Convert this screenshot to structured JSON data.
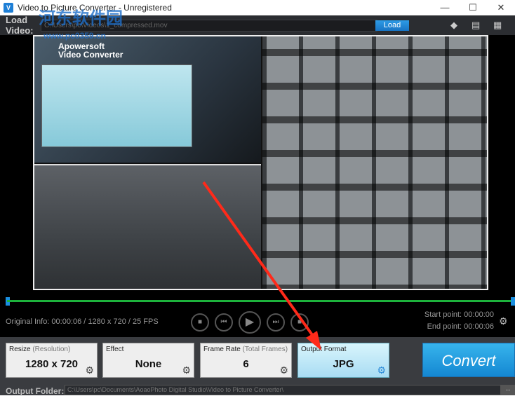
{
  "window": {
    "title": "Video to Picture Converter - Unregistered",
    "minimize": "—",
    "maximize": "☐",
    "close": "✕"
  },
  "load": {
    "label": "Load Video:",
    "path": "C:\\Users\\pc\\Videos\\1_compressed.mov",
    "button": "Load"
  },
  "video": {
    "brand_line1": "Apowersoft",
    "brand_line2": "Video Converter"
  },
  "info": "Original Info: 00:00:06 / 1280 x 720 / 25 FPS",
  "start_point": "Start point: 00:00:00",
  "end_point": "End point: 00:00:06",
  "controls": {
    "stop": "■",
    "prev": "⏮",
    "play": "▶",
    "next": "⏭",
    "snap": "■"
  },
  "cards": [
    {
      "label": "Resize",
      "label_sub": " (Resolution)",
      "value": "1280 x 720"
    },
    {
      "label": "Effect",
      "label_sub": "",
      "value": "None"
    },
    {
      "label": "Frame Rate",
      "label_sub": " (Total Frames)",
      "value": "6"
    },
    {
      "label": "Output Format",
      "label_sub": "",
      "value": "JPG"
    }
  ],
  "convert": "Convert",
  "output": {
    "label": "Output Folder:",
    "path": "C:\\Users\\pc\\Documents\\AoaoPhoto Digital Studio\\Video to Picture Converter\\",
    "browse": "..."
  },
  "watermark": {
    "line1": "河东软件园",
    "line2": "www.pc0359.cn"
  },
  "colors": {
    "accent": "#1a8fe0",
    "timeline": "#1db33c",
    "arrow": "#ff2a1a"
  }
}
